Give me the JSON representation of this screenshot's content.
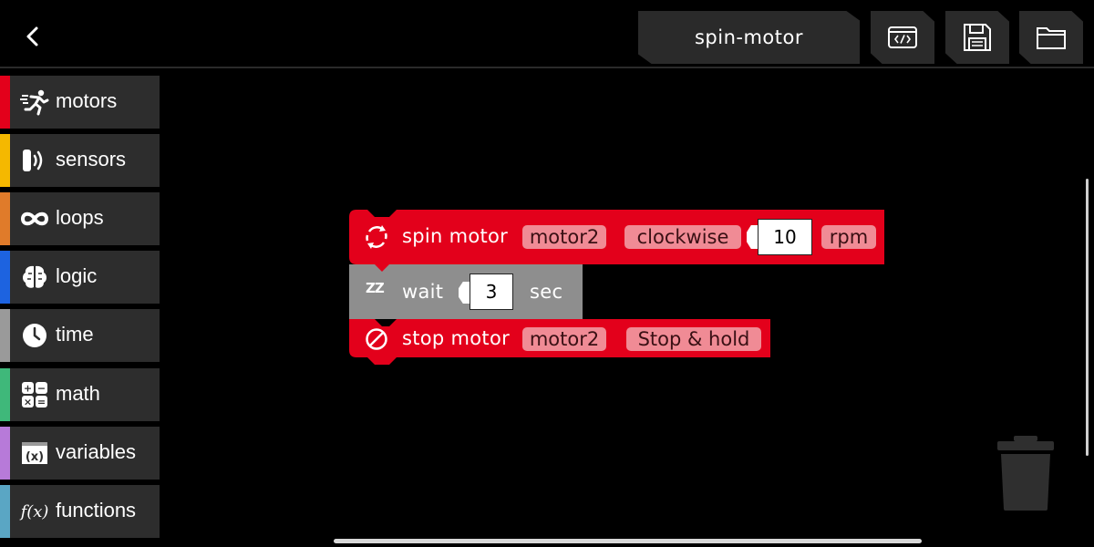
{
  "header": {
    "project_name": "spin-motor",
    "buttons": [
      "code-view",
      "save",
      "open-folder"
    ]
  },
  "sidebar": {
    "items": [
      {
        "label": "motors",
        "color": "#e3001b",
        "icon": "running-man-icon"
      },
      {
        "label": "sensors",
        "color": "#f5b800",
        "icon": "sensor-icon"
      },
      {
        "label": "loops",
        "color": "#e07b2a",
        "icon": "infinity-icon"
      },
      {
        "label": "logic",
        "color": "#1d63e0",
        "icon": "brain-icon"
      },
      {
        "label": "time",
        "color": "#9a9a9a",
        "icon": "clock-icon"
      },
      {
        "label": "math",
        "color": "#3fb87a",
        "icon": "calculator-icon"
      },
      {
        "label": "variables",
        "color": "#b77ad9",
        "icon": "variable-x-icon"
      },
      {
        "label": "functions",
        "color": "#5aa6c4",
        "icon": "function-fx-icon"
      }
    ],
    "math_icon_glyphs": [
      "+",
      "−",
      "×",
      "="
    ],
    "variables_icon_text": "(x)",
    "functions_icon_text": "f(x)"
  },
  "blocks": {
    "spin": {
      "label": "spin motor",
      "motor": "motor2",
      "direction": "clockwise",
      "speed": "10",
      "unit": "rpm",
      "color": "#e3001b"
    },
    "wait": {
      "label": "wait",
      "value": "3",
      "unit": "sec",
      "color": "#8e8e8e",
      "icon_text": "ZZ"
    },
    "stop": {
      "label": "stop motor",
      "motor": "motor2",
      "mode": "Stop & hold",
      "color": "#e3001b"
    }
  },
  "colors": {
    "background": "#000000",
    "panel": "#2d2d2d",
    "chip": "#f08b95"
  }
}
